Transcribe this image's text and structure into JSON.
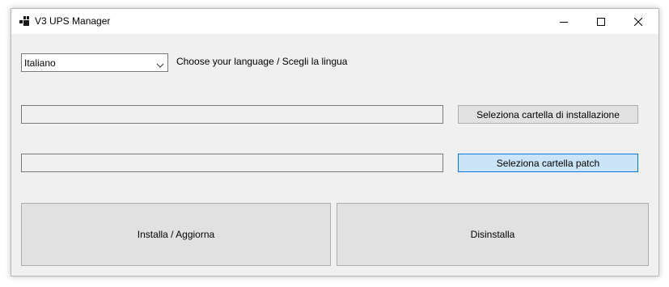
{
  "window": {
    "title": "V3 UPS Manager"
  },
  "language": {
    "selected": "Italiano",
    "label": "Choose your language / Scegli la lingua"
  },
  "install_folder": {
    "value": "",
    "button_label": "Seleziona cartella di installazione"
  },
  "patch_folder": {
    "value": "",
    "button_label": "Seleziona cartella patch"
  },
  "actions": {
    "install_label": "Installa / Aggiorna",
    "uninstall_label": "Disinstalla"
  },
  "icons": {
    "app": "app-icon",
    "minimize": "minimize-icon",
    "maximize": "maximize-icon",
    "close": "close-icon",
    "dropdown": "chevron-down-icon"
  },
  "colors": {
    "window_background": "#f0f0f0",
    "titlebar": "#ffffff",
    "button_face": "#e1e1e1",
    "focused_button": "#cce4f7",
    "focus_border": "#0078d7"
  }
}
